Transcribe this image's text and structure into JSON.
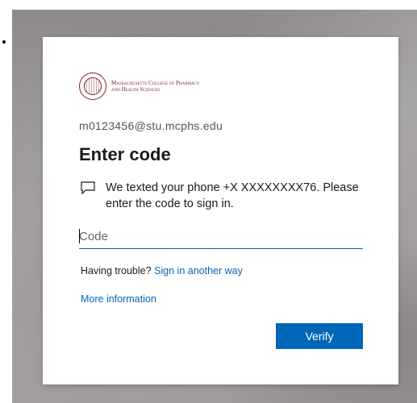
{
  "org": {
    "name_line1": "Massachusetts College of Pharmacy",
    "name_line2": "and Health Sciences",
    "accent_color": "#7a1c2a"
  },
  "identity": "m0123456@stu.mcphs.edu",
  "title": "Enter code",
  "message": {
    "icon": "chat-bubble-icon",
    "text": "We texted your phone +X XXXXXXXX76. Please enter the code to sign in."
  },
  "code_input": {
    "placeholder": "Code",
    "value": ""
  },
  "trouble": {
    "label": "Having trouble?",
    "link_text": "Sign in another way"
  },
  "more_info_link": "More information",
  "verify_button": "Verify",
  "colors": {
    "primary": "#0067b8",
    "text": "#1b1b1b"
  }
}
